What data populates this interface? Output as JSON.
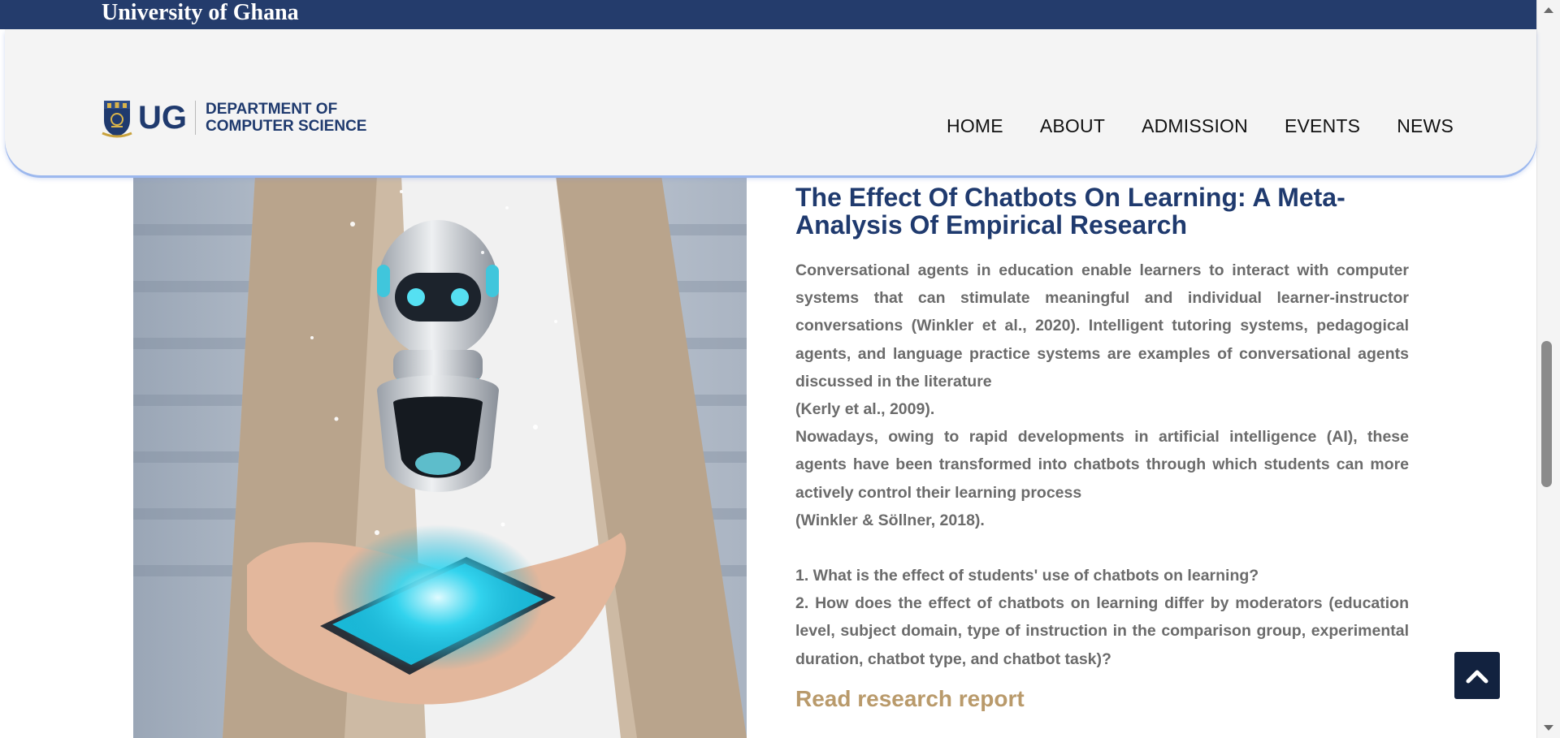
{
  "topbar": {
    "title": "University of Ghana"
  },
  "header": {
    "logo": {
      "mark": "UG",
      "dept_line1": "DEPARTMENT OF",
      "dept_line2": "COMPUTER SCIENCE"
    },
    "nav": [
      {
        "label": "HOME"
      },
      {
        "label": "ABOUT"
      },
      {
        "label": "ADMISSION"
      },
      {
        "label": "EVENTS"
      },
      {
        "label": "NEWS"
      }
    ]
  },
  "article": {
    "title_line1": "The Effect Of Chatbots On Learning: A Meta-",
    "title_line2": "Analysis Of Empirical Research",
    "paragraphs": [
      "Conversational agents in education enable learners to interact with computer systems that can stimulate meaningful and individual learner-instructor conversations (Winkler et al., 2020). Intelligent tutoring systems, pedagogical agents, and language practice systems are examples of conversational agents discussed in the literature",
      "(Kerly et al., 2009).",
      "Nowadays, owing to rapid developments in artificial intelligence (AI), these agents have been transformed into chatbots through which students can more actively control their learning process",
      "(Winkler & Söllner, 2018).",
      "1. What is the effect of students' use of chatbots on learning?",
      "2. How does the effect of chatbots on learning differ by moderators (education level, subject domain, type of instruction in the comparison group, experimental duration, chatbot type, and chatbot task)?"
    ],
    "read_link": "Read research report"
  },
  "icons": {
    "back_to_top": "chevron-up-icon",
    "crest": "university-crest-icon"
  },
  "colors": {
    "brand_navy": "#243c6c",
    "title_blue": "#1f3a6e",
    "link_gold": "#b99a6b",
    "body_gray": "#6b6b6b"
  }
}
